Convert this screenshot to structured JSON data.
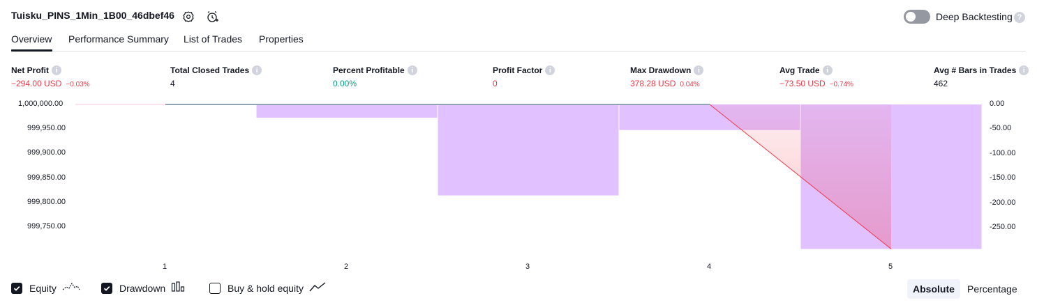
{
  "header": {
    "strategy_title": "Tuisku_PINS_1Min_1B00_46dbef46",
    "settings_icon": "gear-icon",
    "add_alert_icon": "alarm-clock-plus-icon",
    "deep_backtesting_label": "Deep Backtesting",
    "deep_backtesting_enabled": false
  },
  "tabs": [
    {
      "label": "Overview",
      "active": true
    },
    {
      "label": "Performance Summary",
      "active": false
    },
    {
      "label": "List of Trades",
      "active": false
    },
    {
      "label": "Properties",
      "active": false
    }
  ],
  "metrics": {
    "net_profit": {
      "label": "Net Profit",
      "value": "−294.00 USD",
      "sub": "−0.03%"
    },
    "total_closed_trades": {
      "label": "Total Closed Trades",
      "value": "4"
    },
    "percent_profitable": {
      "label": "Percent Profitable",
      "value": "0.00%"
    },
    "profit_factor": {
      "label": "Profit Factor",
      "value": "0"
    },
    "max_drawdown": {
      "label": "Max Drawdown",
      "value": "378.28 USD",
      "sub": "0.04%"
    },
    "avg_trade": {
      "label": "Avg Trade",
      "value": "−73.50 USD",
      "sub": "−0.74%"
    },
    "avg_bars": {
      "label": "Avg # Bars in Trades",
      "value": "462"
    }
  },
  "chart_data": {
    "type": "bar",
    "left_axis_ticks": [
      "1,000,000.00",
      "999,950.00",
      "999,900.00",
      "999,850.00",
      "999,800.00",
      "999,750.00"
    ],
    "right_axis_ticks": [
      "0.00",
      "-50.00",
      "-100.00",
      "-150.00",
      "-200.00",
      "-250.00"
    ],
    "x_ticks": [
      "1",
      "2",
      "3",
      "4",
      "5"
    ],
    "right_ylim": [
      -295,
      0
    ],
    "drawdown_bars": [
      {
        "from_x": 1.5,
        "to_x": 2.5,
        "value": -27
      },
      {
        "from_x": 2.5,
        "to_x": 3.5,
        "value": -185
      },
      {
        "from_x": 3.5,
        "to_x": 4.5,
        "value": -52
      },
      {
        "from_x": 4.5,
        "to_x": 5.5,
        "value": -294
      }
    ],
    "equity": [
      {
        "x": 1,
        "value": 1000000.0
      },
      {
        "x": 4,
        "value": 1000000.0
      },
      {
        "x": 5,
        "value": 999706.0
      }
    ],
    "drawdown_color": "#e1c1ff",
    "equity_flat_color": "#8ea4b0",
    "equity_loss_color": "#f23645"
  },
  "legend": {
    "equity": {
      "label": "Equity",
      "checked": true,
      "icon": "equity-line-icon"
    },
    "drawdown": {
      "label": "Drawdown",
      "checked": true,
      "icon": "drawdown-bars-icon"
    },
    "buy_hold": {
      "label": "Buy & hold equity",
      "checked": false,
      "icon": "buy-hold-line-icon"
    }
  },
  "scale_toggle": {
    "options": [
      "Absolute",
      "Percentage"
    ],
    "selected": "Absolute"
  },
  "colors": {
    "negative": "#f23645",
    "positive": "#089981",
    "text": "#131722"
  }
}
